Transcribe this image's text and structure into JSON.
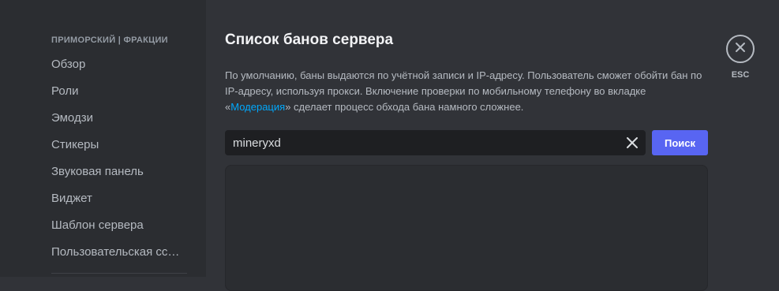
{
  "sidebar": {
    "header": "ПРИМОРСКИЙ | ФРАКЦИИ",
    "items": [
      {
        "label": "Обзор"
      },
      {
        "label": "Роли"
      },
      {
        "label": "Эмодзи"
      },
      {
        "label": "Стикеры"
      },
      {
        "label": "Звуковая панель"
      },
      {
        "label": "Виджет"
      },
      {
        "label": "Шаблон сервера"
      },
      {
        "label": "Пользовательская ссылка"
      }
    ]
  },
  "main": {
    "title": "Список банов сервера",
    "description": {
      "text_before": "По умолчанию, баны выдаются по учётной записи и IP-адресу. Пользователь сможет обойти бан по IP-адресу, используя прокси. Включение проверки по мобильному телефону во вкладке «",
      "link": "Модерация",
      "text_after": "» сделает процесс обхода бана намного сложнее."
    },
    "search": {
      "value": "mineryxd",
      "button_label": "Поиск"
    }
  },
  "close": {
    "icon": "close-icon",
    "label": "ESC"
  },
  "colors": {
    "accent": "#5865f2",
    "link": "#00a8fc",
    "background": "#313338",
    "sidebar": "#2b2d31"
  }
}
